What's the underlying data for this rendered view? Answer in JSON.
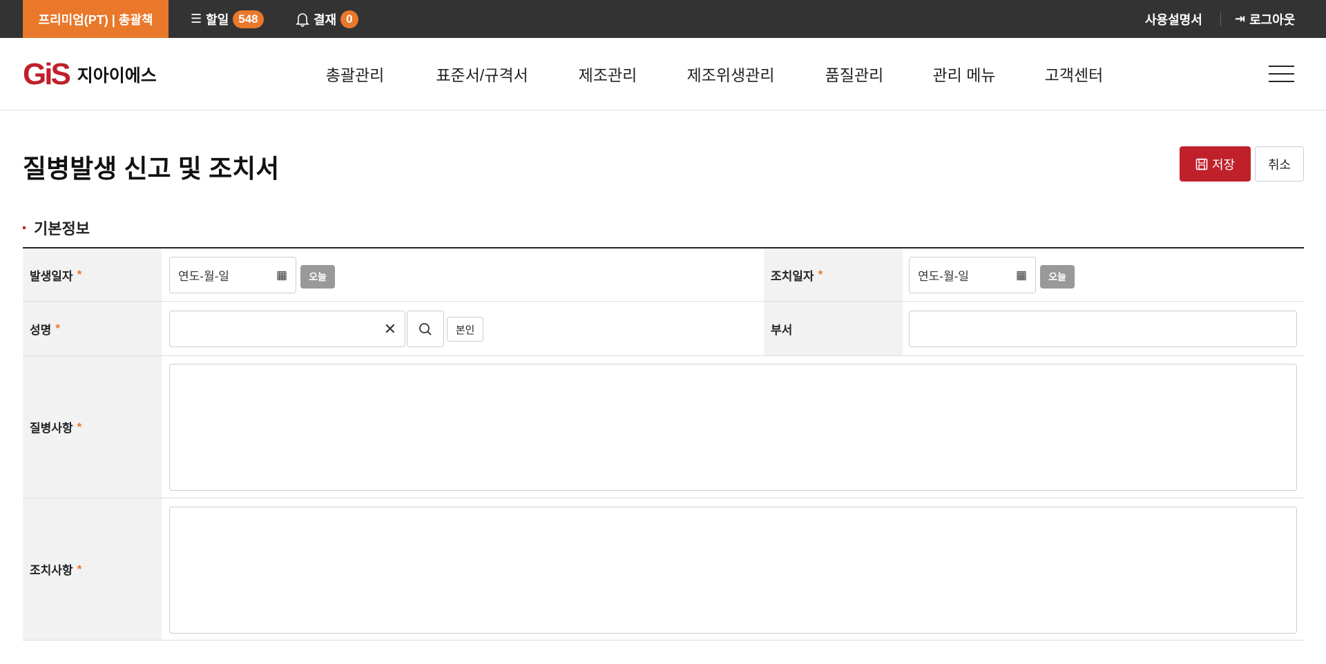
{
  "topbar": {
    "plan": "프리미엄(PT) | 총괄책",
    "todo_label": "할일",
    "todo_count": "548",
    "approval_label": "결재",
    "approval_count": "0",
    "manual": "사용설명서",
    "logout": "로그아웃"
  },
  "header": {
    "logo_mark": "GiS",
    "logo_text": "지아이에스",
    "nav": [
      "총괄관리",
      "표준서/규격서",
      "제조관리",
      "제조위생관리",
      "품질관리",
      "관리 메뉴",
      "고객센터"
    ]
  },
  "page": {
    "title": "질병발생 신고 및 조치서",
    "save": "저장",
    "cancel": "취소",
    "section": "기본정보"
  },
  "form": {
    "occur_date": {
      "label": "발생일자",
      "placeholder": "연도-월-일",
      "today": "오늘"
    },
    "action_date": {
      "label": "조치일자",
      "placeholder": "연도-월-일",
      "today": "오늘"
    },
    "name": {
      "label": "성명",
      "value": "",
      "self": "본인"
    },
    "dept": {
      "label": "부서",
      "value": ""
    },
    "disease": {
      "label": "질병사항",
      "value": ""
    },
    "action": {
      "label": "조치사항",
      "value": ""
    },
    "required_mark": "*"
  },
  "colors": {
    "accent": "#e9782b",
    "brand": "#c0202a"
  }
}
